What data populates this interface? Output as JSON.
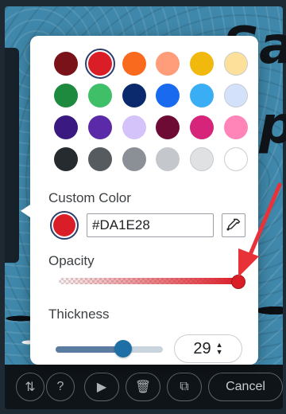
{
  "background": {
    "letters": [
      "Sall",
      "Spi"
    ]
  },
  "toolbar": {
    "buttons": [
      {
        "name": "sort-icon",
        "glyph": "⇅"
      },
      {
        "name": "help-icon",
        "glyph": "?"
      },
      {
        "name": "play-icon",
        "glyph": "▶"
      },
      {
        "name": "trash-icon",
        "glyph": "🗑"
      },
      {
        "name": "copy-icon",
        "glyph": "⧉"
      }
    ],
    "cancel_label": "Cancel"
  },
  "popover": {
    "swatches": [
      "#7a1219",
      "#da1e28",
      "#fa6a1e",
      "#ff9d7a",
      "#f1b80e",
      "#fde19a",
      "#1e8a3e",
      "#3fbf68",
      "#0b2a6e",
      "#1a6af0",
      "#3aaef5",
      "#d3e2fa",
      "#3a1a80",
      "#5b2aa8",
      "#d4c2fb",
      "#6e0b35",
      "#d6247a",
      "#ff84b8",
      "#262b30",
      "#565b60",
      "#8b9096",
      "#c4c8cc",
      "#dfe1e3",
      "#ffffff"
    ],
    "selected_index": 1,
    "custom_color_label": "Custom Color",
    "custom_color_value": "#DA1E28",
    "opacity_label": "Opacity",
    "opacity_value": 1.0,
    "thickness_label": "Thickness",
    "thickness_value": "29",
    "thickness_level": 0.63
  },
  "colors": {
    "accent": "#da1e28",
    "annotation": "#e8323a",
    "slider_thumb": "#1d6fa5"
  }
}
